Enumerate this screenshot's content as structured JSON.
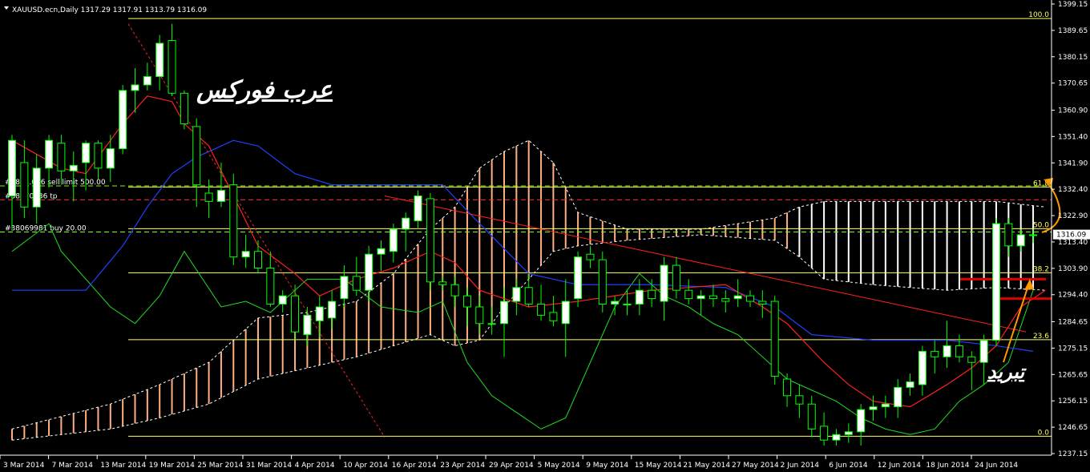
{
  "chart_data": {
    "type": "candlestick",
    "symbol_header": "XAUUSD.ecn,Daily  1317.29 1317.91 1313.79 1316.09",
    "ylim": [
      1237.15,
      1399.15
    ],
    "y_ticks": [
      "1399.15",
      "1389.65",
      "1380.15",
      "1370.65",
      "1360.90",
      "1351.40",
      "1341.90",
      "1332.40",
      "1322.90",
      "1313.40",
      "1303.90",
      "1294.40",
      "1284.65",
      "1275.15",
      "1265.65",
      "1256.15",
      "1246.65",
      "1237.15"
    ],
    "x_labels": [
      "3 Mar 2014",
      "7 Mar 2014",
      "13 Mar 2014",
      "19 Mar 2014",
      "25 Mar 2014",
      "31 Mar 2014",
      "4 Apr 2014",
      "10 Apr 2014",
      "16 Apr 2014",
      "23 Apr 2014",
      "29 Apr 2014",
      "5 May 2014",
      "9 May 2014",
      "15 May 2014",
      "21 May 2014",
      "27 May 2014",
      "2 Jun 2014",
      "6 Jun 2014",
      "12 Jun 2014",
      "18 Jun 2014",
      "24 Jun 2014"
    ],
    "current_price": "1316.09",
    "candles": [
      {
        "o": 1330,
        "h": 1352,
        "l": 1318,
        "c": 1350
      },
      {
        "o": 1342,
        "h": 1350,
        "l": 1322,
        "c": 1326
      },
      {
        "o": 1326,
        "h": 1345,
        "l": 1320,
        "c": 1340
      },
      {
        "o": 1340,
        "h": 1352,
        "l": 1333,
        "c": 1350
      },
      {
        "o": 1349,
        "h": 1352,
        "l": 1334,
        "c": 1339
      },
      {
        "o": 1339,
        "h": 1346,
        "l": 1328,
        "c": 1341
      },
      {
        "o": 1342,
        "h": 1350,
        "l": 1332,
        "c": 1349
      },
      {
        "o": 1349,
        "h": 1350,
        "l": 1336,
        "c": 1340
      },
      {
        "o": 1340,
        "h": 1352,
        "l": 1335,
        "c": 1347
      },
      {
        "o": 1347,
        "h": 1370,
        "l": 1345,
        "c": 1368
      },
      {
        "o": 1368,
        "h": 1376,
        "l": 1360,
        "c": 1370
      },
      {
        "o": 1370,
        "h": 1378,
        "l": 1368,
        "c": 1373
      },
      {
        "o": 1373,
        "h": 1388,
        "l": 1368,
        "c": 1385
      },
      {
        "o": 1386,
        "h": 1392,
        "l": 1366,
        "c": 1367
      },
      {
        "o": 1367,
        "h": 1368,
        "l": 1354,
        "c": 1356
      },
      {
        "o": 1355,
        "h": 1358,
        "l": 1326,
        "c": 1334
      },
      {
        "o": 1331,
        "h": 1336,
        "l": 1322,
        "c": 1328
      },
      {
        "o": 1328,
        "h": 1342,
        "l": 1326,
        "c": 1332
      },
      {
        "o": 1334,
        "h": 1338,
        "l": 1305,
        "c": 1308
      },
      {
        "o": 1308,
        "h": 1316,
        "l": 1304,
        "c": 1310
      },
      {
        "o": 1310,
        "h": 1314,
        "l": 1302,
        "c": 1304
      },
      {
        "o": 1304,
        "h": 1310,
        "l": 1290,
        "c": 1291
      },
      {
        "o": 1291,
        "h": 1296,
        "l": 1288,
        "c": 1294
      },
      {
        "o": 1294,
        "h": 1298,
        "l": 1278,
        "c": 1281
      },
      {
        "o": 1280,
        "h": 1290,
        "l": 1276,
        "c": 1287
      },
      {
        "o": 1285,
        "h": 1294,
        "l": 1279,
        "c": 1290
      },
      {
        "o": 1286,
        "h": 1296,
        "l": 1282,
        "c": 1292
      },
      {
        "o": 1293,
        "h": 1305,
        "l": 1290,
        "c": 1301
      },
      {
        "o": 1301,
        "h": 1308,
        "l": 1294,
        "c": 1296
      },
      {
        "o": 1296,
        "h": 1312,
        "l": 1292,
        "c": 1309
      },
      {
        "o": 1309,
        "h": 1314,
        "l": 1303,
        "c": 1311
      },
      {
        "o": 1310,
        "h": 1320,
        "l": 1306,
        "c": 1318
      },
      {
        "o": 1318,
        "h": 1324,
        "l": 1310,
        "c": 1322
      },
      {
        "o": 1321,
        "h": 1332,
        "l": 1318,
        "c": 1330
      },
      {
        "o": 1329,
        "h": 1331,
        "l": 1296,
        "c": 1299
      },
      {
        "o": 1299,
        "h": 1301,
        "l": 1296,
        "c": 1298
      },
      {
        "o": 1298,
        "h": 1301,
        "l": 1290,
        "c": 1294
      },
      {
        "o": 1294,
        "h": 1297,
        "l": 1283,
        "c": 1290
      },
      {
        "o": 1290,
        "h": 1294,
        "l": 1280,
        "c": 1284
      },
      {
        "o": 1284,
        "h": 1290,
        "l": 1280,
        "c": 1284
      },
      {
        "o": 1284,
        "h": 1297,
        "l": 1272,
        "c": 1292
      },
      {
        "o": 1292,
        "h": 1300,
        "l": 1287,
        "c": 1297
      },
      {
        "o": 1297,
        "h": 1302,
        "l": 1290,
        "c": 1291
      },
      {
        "o": 1291,
        "h": 1298,
        "l": 1285,
        "c": 1287
      },
      {
        "o": 1288,
        "h": 1294,
        "l": 1283,
        "c": 1285
      },
      {
        "o": 1284,
        "h": 1300,
        "l": 1272,
        "c": 1292
      },
      {
        "o": 1293,
        "h": 1310,
        "l": 1290,
        "c": 1308
      },
      {
        "o": 1309,
        "h": 1312,
        "l": 1304,
        "c": 1307
      },
      {
        "o": 1307,
        "h": 1310,
        "l": 1288,
        "c": 1291
      },
      {
        "o": 1291,
        "h": 1294,
        "l": 1287,
        "c": 1292
      },
      {
        "o": 1291,
        "h": 1296,
        "l": 1287,
        "c": 1291
      },
      {
        "o": 1291,
        "h": 1300,
        "l": 1287,
        "c": 1296
      },
      {
        "o": 1296,
        "h": 1300,
        "l": 1290,
        "c": 1293
      },
      {
        "o": 1292,
        "h": 1308,
        "l": 1285,
        "c": 1305
      },
      {
        "o": 1305,
        "h": 1308,
        "l": 1293,
        "c": 1296
      },
      {
        "o": 1296,
        "h": 1300,
        "l": 1291,
        "c": 1293
      },
      {
        "o": 1293,
        "h": 1296,
        "l": 1287,
        "c": 1294
      },
      {
        "o": 1294,
        "h": 1298,
        "l": 1290,
        "c": 1293
      },
      {
        "o": 1293,
        "h": 1296,
        "l": 1288,
        "c": 1292
      },
      {
        "o": 1293,
        "h": 1300,
        "l": 1290,
        "c": 1294
      },
      {
        "o": 1294,
        "h": 1296,
        "l": 1290,
        "c": 1292
      },
      {
        "o": 1292,
        "h": 1296,
        "l": 1286,
        "c": 1291
      },
      {
        "o": 1292,
        "h": 1294,
        "l": 1262,
        "c": 1265
      },
      {
        "o": 1264,
        "h": 1266,
        "l": 1254,
        "c": 1258
      },
      {
        "o": 1258,
        "h": 1262,
        "l": 1250,
        "c": 1255
      },
      {
        "o": 1255,
        "h": 1258,
        "l": 1243,
        "c": 1246
      },
      {
        "o": 1247,
        "h": 1252,
        "l": 1240,
        "c": 1242
      },
      {
        "o": 1242,
        "h": 1246,
        "l": 1240,
        "c": 1244
      },
      {
        "o": 1244,
        "h": 1248,
        "l": 1241,
        "c": 1245
      },
      {
        "o": 1245,
        "h": 1255,
        "l": 1240,
        "c": 1253
      },
      {
        "o": 1253,
        "h": 1258,
        "l": 1249,
        "c": 1254
      },
      {
        "o": 1254,
        "h": 1258,
        "l": 1250,
        "c": 1255
      },
      {
        "o": 1254,
        "h": 1264,
        "l": 1250,
        "c": 1261
      },
      {
        "o": 1261,
        "h": 1266,
        "l": 1258,
        "c": 1263
      },
      {
        "o": 1262,
        "h": 1276,
        "l": 1258,
        "c": 1274
      },
      {
        "o": 1274,
        "h": 1278,
        "l": 1266,
        "c": 1272
      },
      {
        "o": 1272,
        "h": 1285,
        "l": 1268,
        "c": 1276
      },
      {
        "o": 1276,
        "h": 1280,
        "l": 1270,
        "c": 1272
      },
      {
        "o": 1272,
        "h": 1274,
        "l": 1260,
        "c": 1270
      },
      {
        "o": 1270,
        "h": 1280,
        "l": 1262,
        "c": 1278
      },
      {
        "o": 1278,
        "h": 1322,
        "l": 1276,
        "c": 1320
      },
      {
        "o": 1320,
        "h": 1322,
        "l": 1308,
        "c": 1312
      },
      {
        "o": 1312,
        "h": 1318,
        "l": 1310,
        "c": 1316
      },
      {
        "o": 1316,
        "h": 1318,
        "l": 1313,
        "c": 1316
      }
    ],
    "horizontal_levels": [
      {
        "price": 1393.9,
        "label": "100.0",
        "color": "#ffff66"
      },
      {
        "price": 1333.2,
        "label": "61.8",
        "color": "#ffff66"
      },
      {
        "price": 1318.2,
        "label": "50.0",
        "color": "#ffff66"
      },
      {
        "price": 1302.3,
        "label": "38.2",
        "color": "#ffff66"
      },
      {
        "price": 1278.2,
        "label": "23.6",
        "color": "#ffff66"
      },
      {
        "price": 1243.4,
        "label": "0.0",
        "color": "#ffff66"
      }
    ],
    "orders": [
      {
        "label": "#380...036 sell limit 500.00",
        "price": 1333.6,
        "color": "#7cfc00"
      },
      {
        "label": "#38070036 tp",
        "price": 1328.6,
        "color": "#ff3b3b"
      },
      {
        "label": "#38069981 buy 20.00",
        "price": 1317.0,
        "color": "#7cfc00"
      }
    ],
    "annotations": [
      "عرب فوركس",
      "تبريد"
    ],
    "colors": {
      "bull": "#ffffff",
      "bear": "#000000",
      "wick": "#00ff00",
      "tenkan": "#ff2020",
      "kijun": "#2040ff",
      "chikou": "#22dd22",
      "cloud_up": "#ffb080",
      "cloud_down": "#ffffff",
      "fib": "#ffff66",
      "trend": "#ff2020",
      "arrow": "#ff9900",
      "support": "#e00000"
    }
  }
}
